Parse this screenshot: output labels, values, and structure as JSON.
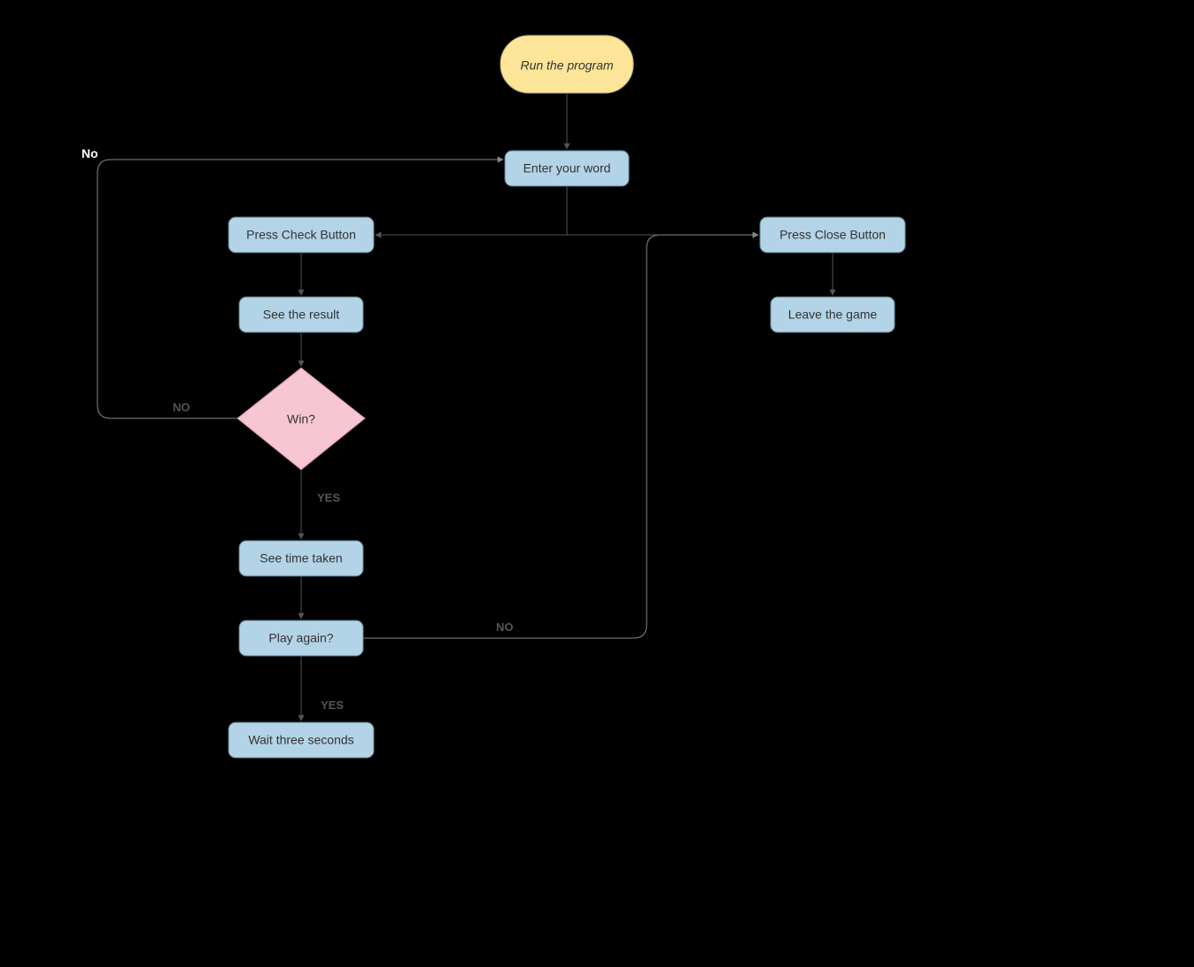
{
  "nodes": {
    "start": {
      "label": "Run the program"
    },
    "enter_word": {
      "label": "Enter your word"
    },
    "press_check": {
      "label": "Press Check Button"
    },
    "see_result": {
      "label": "See the result"
    },
    "win": {
      "label": "Win?"
    },
    "see_time": {
      "label": "See time taken"
    },
    "play_again": {
      "label": "Play again?"
    },
    "wait_three": {
      "label": "Wait three seconds"
    },
    "press_close": {
      "label": "Press Close Button"
    },
    "leave_game": {
      "label": "Leave the game"
    }
  },
  "edges": {
    "top_no": "No",
    "win_no": "NO",
    "win_yes": "YES",
    "play_again_no": "NO",
    "play_again_yes": "YES"
  }
}
